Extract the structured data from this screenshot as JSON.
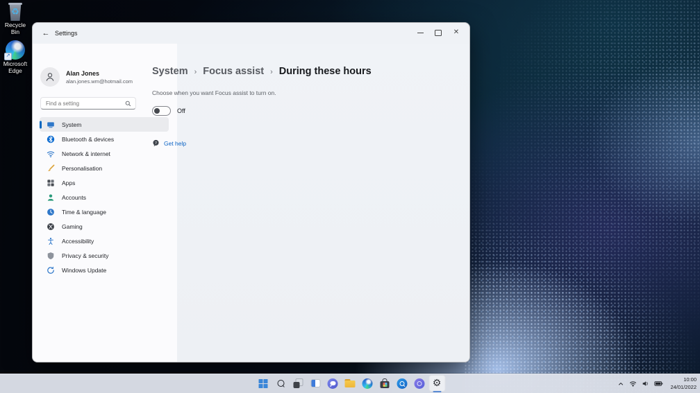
{
  "desktop": {
    "icons": [
      {
        "label": "Recycle Bin"
      },
      {
        "label": "Microsoft Edge"
      }
    ]
  },
  "window": {
    "title": "Settings",
    "user": {
      "name": "Alan Jones",
      "email": "alan.jones.wm@hotmail.com"
    },
    "search": {
      "placeholder": "Find a setting"
    },
    "nav": [
      {
        "label": "System",
        "selected": true
      },
      {
        "label": "Bluetooth & devices"
      },
      {
        "label": "Network & internet"
      },
      {
        "label": "Personalisation"
      },
      {
        "label": "Apps"
      },
      {
        "label": "Accounts"
      },
      {
        "label": "Time & language"
      },
      {
        "label": "Gaming"
      },
      {
        "label": "Accessibility"
      },
      {
        "label": "Privacy & security"
      },
      {
        "label": "Windows Update"
      }
    ],
    "page": {
      "breadcrumb": [
        {
          "label": "System"
        },
        {
          "label": "Focus assist"
        },
        {
          "label": "During these hours"
        }
      ],
      "breadcrumb_separator": "›",
      "description": "Choose when you want Focus assist to turn on.",
      "focus_toggle": {
        "label": "Off",
        "state": "off"
      },
      "get_help_label": "Get help"
    }
  },
  "taskbar": {
    "icons": [
      "start",
      "search",
      "task-view",
      "widgets",
      "chat",
      "file-explorer",
      "edge",
      "store",
      "search-app",
      "cortana",
      "settings"
    ],
    "active_icon": "settings",
    "tray": {
      "icons": [
        "hidden-icons-chevron",
        "wifi",
        "volume",
        "battery"
      ],
      "time": "10:00",
      "date": "24/01/2022"
    }
  },
  "colors": {
    "accent": "#0067c0",
    "link": "#0b63c4",
    "taskbar_bg": "#dbdfe8",
    "sidebar_bg": "#fbfbfd",
    "content_bg": "#eff2f6",
    "selected_nav_bg": "#eaebee"
  }
}
